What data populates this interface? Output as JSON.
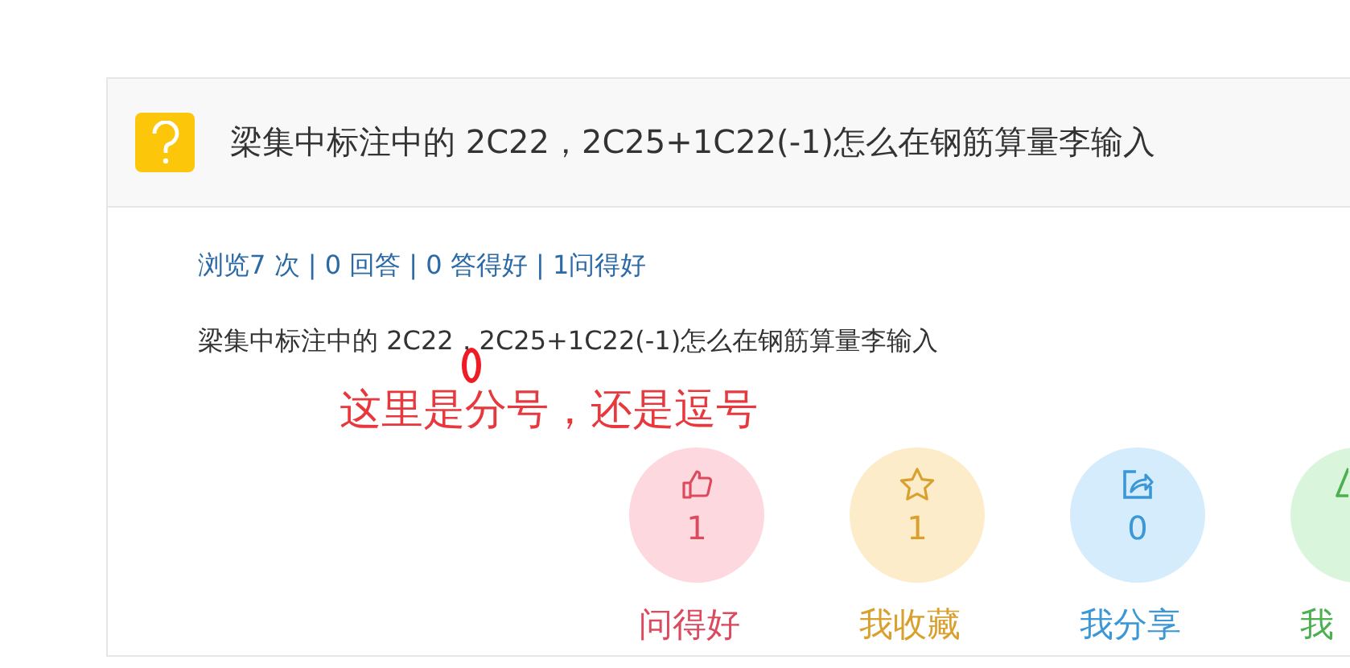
{
  "question": {
    "title": "梁集中标注中的 2C22，2C25+1C22(-1)怎么在钢筋算量李输入",
    "stats": "浏览7 次 | 0 回答 | 0 答得好 | 1问得好",
    "body": "梁集中标注中的 2C22，2C25+1C22(-1)怎么在钢筋算量李输入"
  },
  "annotation": {
    "text": "这里是分号，还是逗号"
  },
  "actions": [
    {
      "kind": "like",
      "count": "1",
      "label": "问得好"
    },
    {
      "kind": "favorite",
      "count": "1",
      "label": "我收藏"
    },
    {
      "kind": "share",
      "count": "0",
      "label": "我分享"
    },
    {
      "kind": "report",
      "label": "我"
    }
  ]
}
